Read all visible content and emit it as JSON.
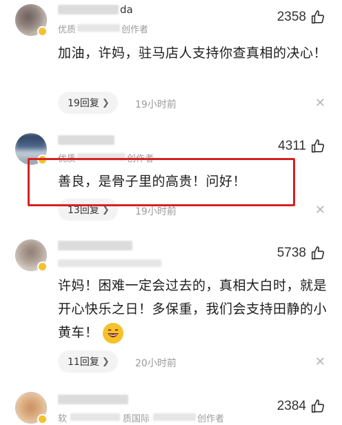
{
  "comments": [
    {
      "name_visible": "da",
      "role_visible": "优质",
      "role_visible_right": "创作者",
      "likes": "2358",
      "text": "加油，许妈，驻马店人支持你查真相的决心！",
      "replies": "19回复",
      "time": "19小时前"
    },
    {
      "role_visible": "优质",
      "role_visible_right": "创作者",
      "likes": "4311",
      "text": "善良，是骨子里的高贵！问好！",
      "replies": "13回复",
      "time": "19小时前"
    },
    {
      "likes": "5738",
      "text": "许妈！困难一定会过去的，真相大白时，就是开心快乐之日！多保重，我们会支持田静的小黄车！",
      "replies": "11回复",
      "time": "20小时前"
    },
    {
      "role_visible": "软",
      "role_visible_mid": "质国际",
      "role_visible_right": "创作者",
      "likes": "2384"
    }
  ],
  "icons": {
    "like": "thumb-up-icon",
    "close": "close-icon",
    "chevron": "chevron-right-icon",
    "emoji": "laughing-emoji-icon"
  },
  "colors": {
    "highlight": "#d8201f",
    "badge": "#f2c230"
  }
}
